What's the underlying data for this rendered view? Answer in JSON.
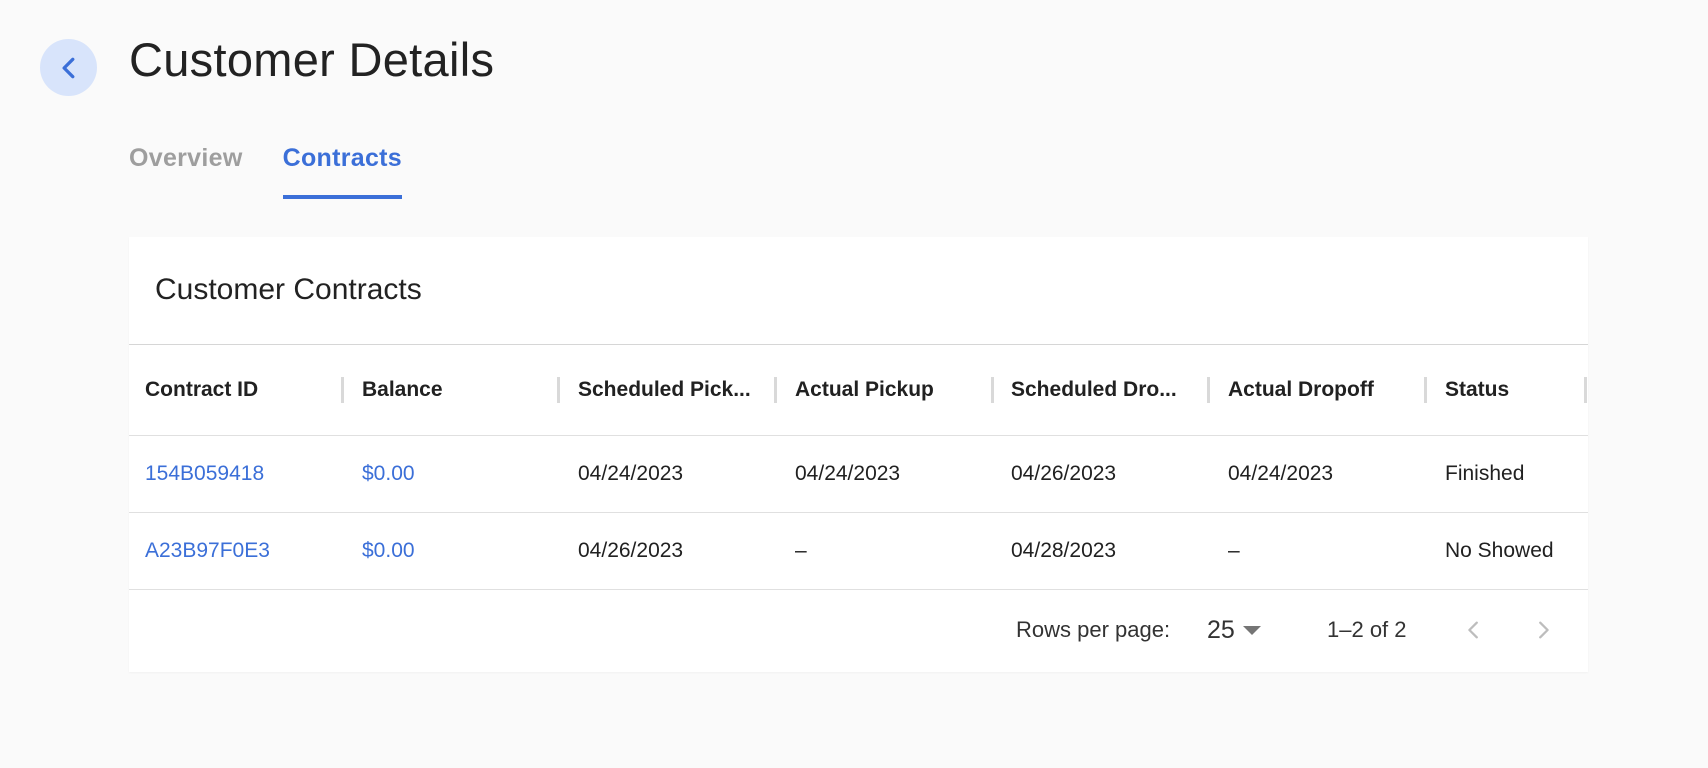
{
  "page": {
    "title": "Customer Details",
    "back_icon": "chevron-left-icon",
    "accent_color": "#3b6fd8"
  },
  "tabs": [
    {
      "label": "Overview",
      "active": false
    },
    {
      "label": "Contracts",
      "active": true
    }
  ],
  "contracts_card": {
    "title": "Customer Contracts",
    "columns": [
      "Contract ID",
      "Balance",
      "Scheduled Pick...",
      "Actual Pickup",
      "Scheduled Dro...",
      "Actual Dropoff",
      "Status"
    ],
    "rows": [
      [
        "154B059418",
        "$0.00",
        "04/24/2023",
        "04/24/2023",
        "04/26/2023",
        "04/24/2023",
        "Finished"
      ],
      [
        "A23B97F0E3",
        "$0.00",
        "04/26/2023",
        "–",
        "04/28/2023",
        "–",
        "No Showed"
      ]
    ],
    "footer": {
      "rows_per_page_label": "Rows per page:",
      "rows_per_page_value": "25",
      "range_text": "1–2 of 2",
      "prev_icon": "chevron-left-icon",
      "next_icon": "chevron-right-icon"
    }
  }
}
